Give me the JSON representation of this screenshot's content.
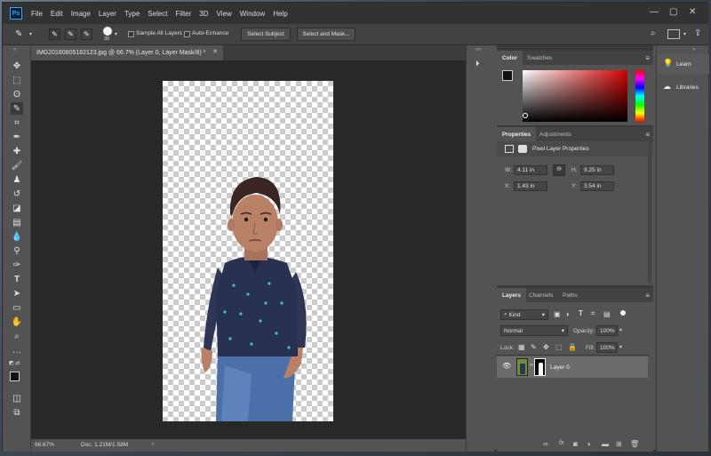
{
  "app": {
    "logo": "Ps"
  },
  "menu": [
    "File",
    "Edit",
    "Image",
    "Layer",
    "Type",
    "Select",
    "Filter",
    "3D",
    "View",
    "Window",
    "Help"
  ],
  "window_controls": {
    "minimize": "—",
    "maximize": "▢",
    "close": "✕"
  },
  "options": {
    "brush_size": "30",
    "sample_all_layers": "Sample All Layers",
    "auto_enhance": "Auto-Enhance",
    "select_subject": "Select Subject",
    "select_and_mask": "Select and Mask..."
  },
  "document": {
    "tab_title": "IMG20180805182123.jpg @ 66.7% (Layer 0, Layer Mask/8) *",
    "zoom": "66.67%",
    "doc_size": "Doc: 1.21M/1.58M"
  },
  "color_panel": {
    "tabs": [
      "Color",
      "Swatches"
    ]
  },
  "properties_panel": {
    "tabs": [
      "Properties",
      "Adjustments"
    ],
    "header": "Pixel Layer Properties",
    "w_label": "W:",
    "w": "4.11 in",
    "h_label": "H:",
    "h": "9.25 in",
    "x_label": "X:",
    "x": "1.43 in",
    "y_label": "Y:",
    "y": "3.54 in"
  },
  "layers_panel": {
    "tabs": [
      "Layers",
      "Channels",
      "Paths"
    ],
    "filter": "Kind",
    "blend_mode": "Normal",
    "opacity_label": "Opacity:",
    "opacity": "100%",
    "lock_label": "Lock:",
    "fill_label": "Fill:",
    "fill": "100%",
    "layer_name": "Layer 0"
  },
  "learn_panel": {
    "learn": "Learn",
    "libraries": "Libraries"
  },
  "colors": {
    "accent": "#31a8ff",
    "canvas_bg": "#282828",
    "panel_bg": "#535353"
  }
}
